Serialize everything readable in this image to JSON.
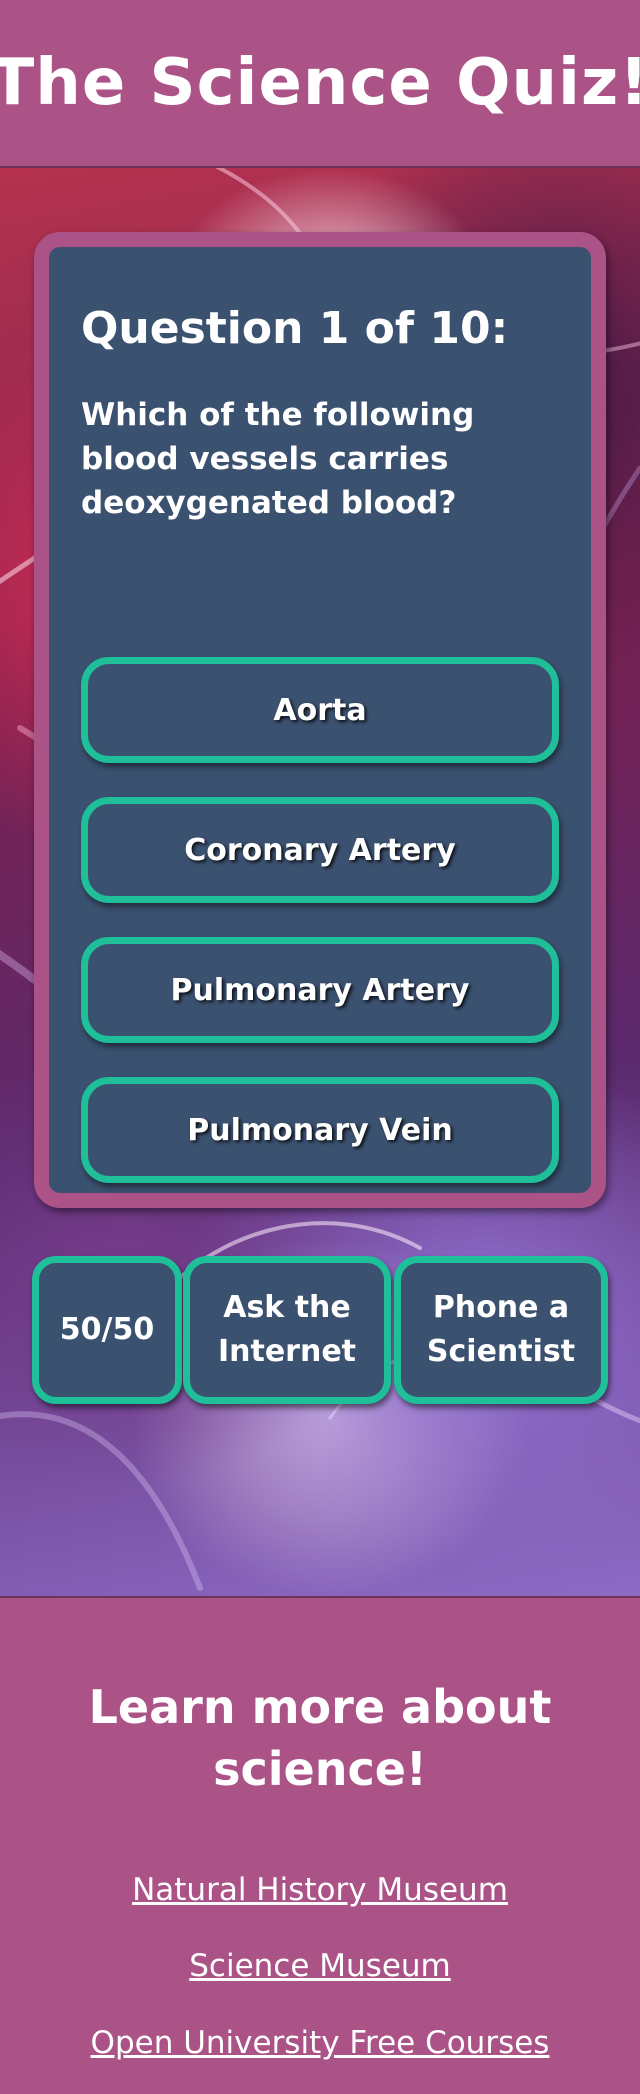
{
  "header": {
    "title": "The Science Quiz!"
  },
  "quiz": {
    "question_heading": "Question 1 of 10:",
    "question_text": "Which of the following blood vessels carries deoxygenated blood?",
    "answers": [
      "Aorta",
      "Coronary Artery",
      "Pulmonary Artery",
      "Pulmonary Vein"
    ]
  },
  "lifelines": {
    "fifty_fifty": "50/50",
    "ask_internet": "Ask the Internet",
    "phone_scientist": "Phone a Scientist"
  },
  "footer": {
    "heading": "Learn more about science!",
    "links": [
      "Natural History Museum",
      "Science Museum",
      "Open University Free Courses"
    ]
  },
  "colors": {
    "brand": "#ab5287",
    "card": "#3b5170",
    "accent": "#1fbf9a",
    "text": "#ffffff"
  }
}
